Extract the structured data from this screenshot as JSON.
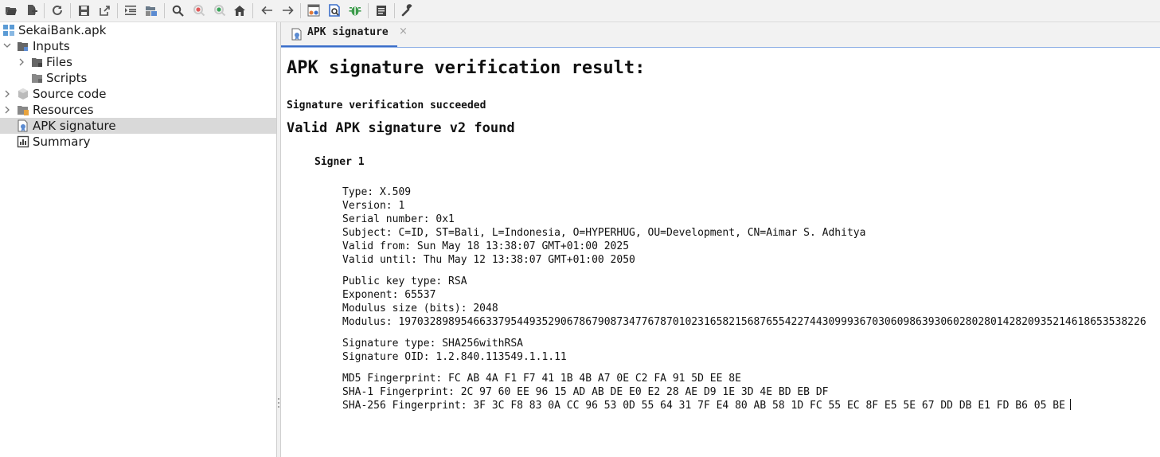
{
  "toolbar": {
    "buttons": [
      {
        "icon": "open-folder-icon"
      },
      {
        "icon": "add-files-icon"
      },
      {
        "icon": "reload-icon"
      },
      {
        "icon": "save-icon"
      },
      {
        "icon": "export-icon"
      },
      {
        "icon": "flatten-packages-icon"
      },
      {
        "icon": "sync-tree-icon"
      },
      {
        "icon": "search-icon"
      },
      {
        "icon": "find-usage-icon"
      },
      {
        "icon": "find-class-icon"
      },
      {
        "icon": "home-icon"
      },
      {
        "icon": "back-arrow-icon"
      },
      {
        "icon": "forward-arrow-icon"
      },
      {
        "icon": "deobfuscation-icon"
      },
      {
        "icon": "quark-icon"
      },
      {
        "icon": "debugger-icon"
      },
      {
        "icon": "log-viewer-icon"
      },
      {
        "icon": "preferences-wrench-icon"
      }
    ]
  },
  "tree": {
    "root": "SekaiBank.apk",
    "items": [
      {
        "label": "Inputs"
      },
      {
        "label": "Files"
      },
      {
        "label": "Scripts"
      },
      {
        "label": "Source code"
      },
      {
        "label": "Resources"
      },
      {
        "label": "APK signature"
      },
      {
        "label": "Summary"
      }
    ]
  },
  "tab": {
    "label": "APK signature",
    "close": "×"
  },
  "content": {
    "title": "APK signature verification result:",
    "status": "Signature verification succeeded",
    "found": "Valid APK signature v2 found",
    "signer": "Signer 1",
    "cert": [
      "Type: X.509",
      "Version: 1",
      "Serial number: 0x1",
      "Subject: C=ID, ST=Bali, L=Indonesia, O=HYPERHUG, OU=Development, CN=Aimar S. Adhitya",
      "Valid from: Sun May 18 13:38:07 GMT+01:00 2025",
      "Valid until: Thu May 12 13:38:07 GMT+01:00 2050"
    ],
    "pubkey": [
      "Public key type: RSA",
      "Exponent: 65537",
      "Modulus size (bits): 2048",
      "Modulus: 197032898954663379544935290678679087347767870102316582156876554227443099936703060986393060280280142820935214618653538226"
    ],
    "sig": [
      "Signature type: SHA256withRSA",
      "Signature OID: 1.2.840.113549.1.1.11"
    ],
    "fingerprints": [
      "MD5 Fingerprint: FC AB 4A F1 F7 41 1B 4B A7 0E C2 FA 91 5D EE 8E",
      "SHA-1 Fingerprint: 2C 97 60 EE 96 15 AD AB DE E0 E2 28 AE D9 1E 3D 4E BD EB DF",
      "SHA-256 Fingerprint: 3F 3C F8 83 0A CC 96 53 0D 55 64 31 7F E4 80 AB 58 1D FC 55 EC 8F E5 5E 67 DD DB E1 FD B6 05 BE"
    ]
  }
}
